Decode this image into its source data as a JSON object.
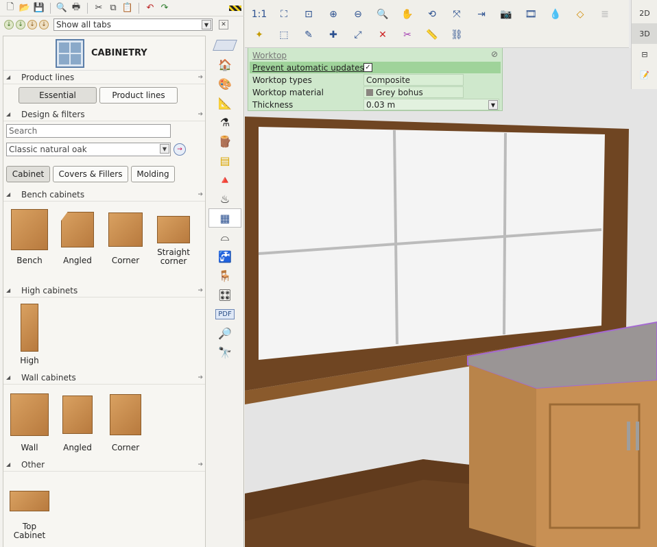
{
  "tab_filter": {
    "value": "Show all tabs"
  },
  "catalog": {
    "title": "CABINETRY",
    "sections": {
      "product_lines": "Product lines",
      "design_filters": "Design & filters",
      "bench_cabinets": "Bench cabinets",
      "high_cabinets": "High cabinets",
      "wall_cabinets": "Wall cabinets",
      "other": "Other"
    },
    "product_line_buttons": [
      "Essential",
      "Product lines"
    ],
    "search_placeholder": "Search",
    "style_value": "Classic natural oak",
    "filter_buttons": [
      "Cabinet",
      "Covers & Fillers",
      "Molding"
    ],
    "bench_items": [
      "Bench",
      "Angled",
      "Corner",
      "Straight corner"
    ],
    "high_items": [
      "High"
    ],
    "wall_items": [
      "Wall",
      "Angled",
      "Corner"
    ],
    "other_items": [
      "Top Cabinet"
    ]
  },
  "view_modes": {
    "two_d": "2D",
    "three_d": "3D"
  },
  "worktop": {
    "title": "Worktop",
    "prevent_label": "Prevent automatic updates",
    "prevent_checked": true,
    "types_label": "Worktop types",
    "types_value": "Composite",
    "material_label": "Worktop material",
    "material_value": "Grey bohus",
    "thickness_label": "Thickness",
    "thickness_value": "0.03 m"
  },
  "pdf_label": "PDF"
}
